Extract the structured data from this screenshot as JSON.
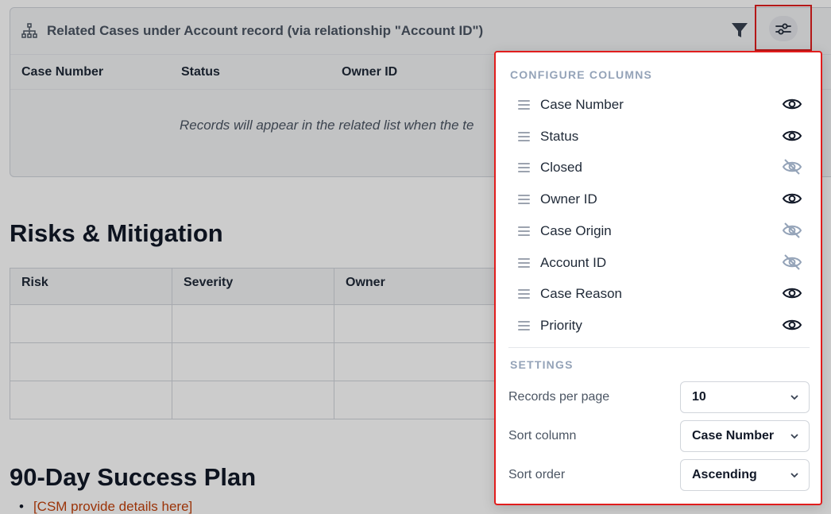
{
  "related": {
    "title": "Related Cases under Account record (via relationship \"Account ID\")",
    "columns": [
      "Case Number",
      "Status",
      "Owner ID"
    ],
    "empty_message": "Records will appear in the related list when the te"
  },
  "risks": {
    "heading": "Risks & Mitigation",
    "columns": [
      "Risk",
      "Severity",
      "Owner"
    ]
  },
  "plan": {
    "heading": "90-Day Success Plan",
    "items": [
      "[CSM provide details here]"
    ]
  },
  "configure": {
    "title": "CONFIGURE COLUMNS",
    "columns": [
      {
        "label": "Case Number",
        "visible": true
      },
      {
        "label": "Status",
        "visible": true
      },
      {
        "label": "Closed",
        "visible": false
      },
      {
        "label": "Owner ID",
        "visible": true
      },
      {
        "label": "Case Origin",
        "visible": false
      },
      {
        "label": "Account ID",
        "visible": false
      },
      {
        "label": "Case Reason",
        "visible": true
      },
      {
        "label": "Priority",
        "visible": true
      }
    ]
  },
  "settings": {
    "title": "SETTINGS",
    "records_per_page": {
      "label": "Records per page",
      "value": "10"
    },
    "sort_column": {
      "label": "Sort column",
      "value": "Case Number"
    },
    "sort_order": {
      "label": "Sort order",
      "value": "Ascending"
    }
  },
  "colors": {
    "highlight": "#e11d1d",
    "link": "#c2410c",
    "muted": "#94a3b8"
  }
}
